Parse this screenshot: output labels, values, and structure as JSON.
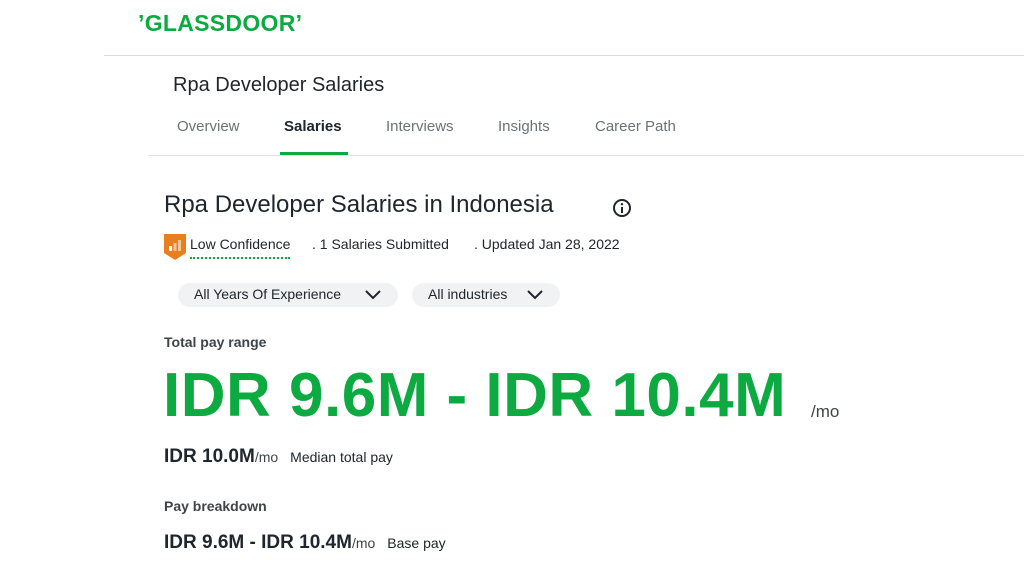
{
  "header": {
    "logo_text": "ʼGLASSDOORʼ"
  },
  "page": {
    "title": "Rpa Developer Salaries"
  },
  "tabs": [
    {
      "label": "Overview",
      "active": false
    },
    {
      "label": "Salaries",
      "active": true
    },
    {
      "label": "Interviews",
      "active": false
    },
    {
      "label": "Insights",
      "active": false
    },
    {
      "label": "Career Path",
      "active": false
    }
  ],
  "section": {
    "title": "Rpa Developer Salaries in Indonesia",
    "info_icon": "info-circle-icon"
  },
  "confidence": {
    "label": "Low Confidence",
    "icon": "low-confidence-badge-icon",
    "submitted": ". 1 Salaries Submitted",
    "updated": ". Updated Jan 28, 2022"
  },
  "filters": [
    {
      "label": "All Years Of Experience",
      "icon": "chevron-down-icon"
    },
    {
      "label": "All industries",
      "icon": "chevron-down-icon"
    }
  ],
  "total_pay": {
    "heading": "Total pay range",
    "range": "IDR 9.6M - IDR 10.4M",
    "unit": "/mo"
  },
  "median": {
    "value": "IDR 10.0M",
    "unit": "/mo",
    "caption": "Median total pay"
  },
  "breakdown": {
    "heading": "Pay breakdown",
    "base_value": "IDR 9.6M - IDR 10.4M",
    "base_unit": "/mo",
    "base_caption": "Base pay"
  },
  "colors": {
    "brand_green": "#0caa41",
    "badge_orange": "#e87f1e"
  }
}
